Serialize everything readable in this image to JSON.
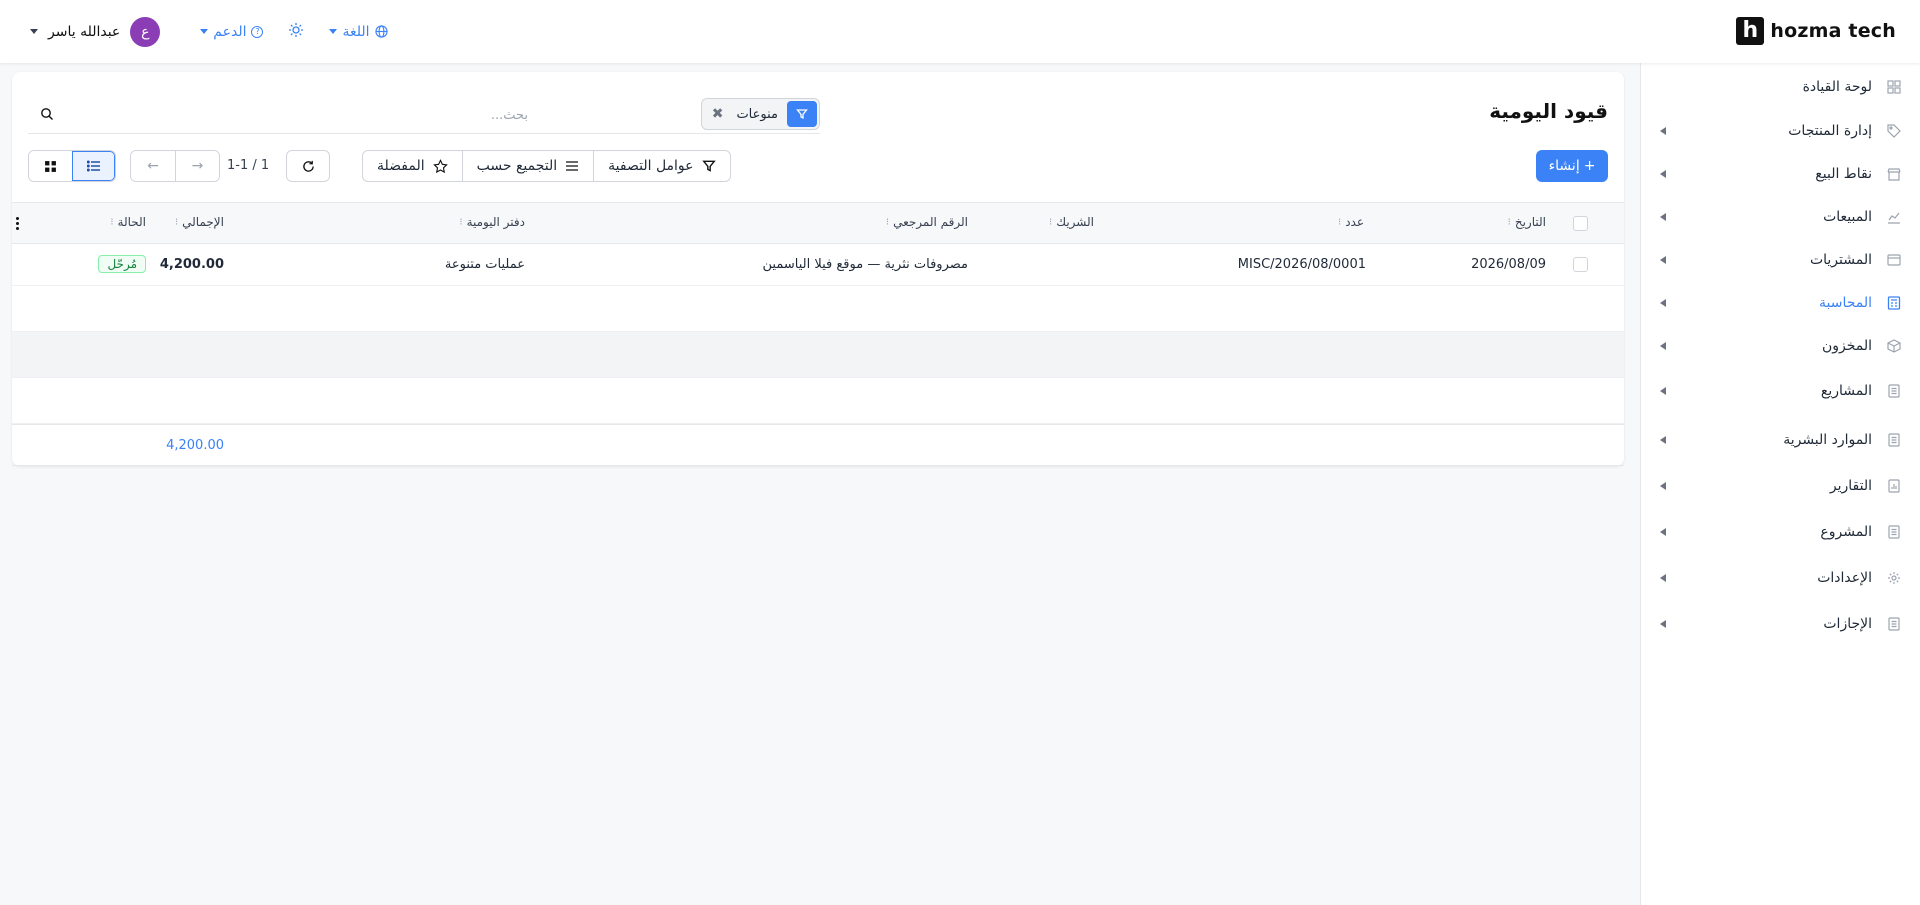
{
  "brand": {
    "logo_letter": "h",
    "name": "hozma tech"
  },
  "header": {
    "user_name": "عبدالله ياسر",
    "avatar_initial": "ع",
    "support_label": "الدعم",
    "language_label": "اللغة"
  },
  "sidebar": {
    "items": [
      {
        "label": "لوحة القيادة",
        "icon": "dashboard-grid-icon"
      },
      {
        "label": "إدارة المنتجات",
        "icon": "tag-icon"
      },
      {
        "label": "نقاط البيع",
        "icon": "store-icon"
      },
      {
        "label": "المبيعات",
        "icon": "trending-chart-icon"
      },
      {
        "label": "المشتريات",
        "icon": "wallet-icon"
      },
      {
        "label": "المحاسبة",
        "icon": "calculator-icon",
        "active": true
      },
      {
        "label": "المخزون",
        "icon": "box-icon"
      },
      {
        "label": "المشاريع",
        "icon": "document-icon"
      },
      {
        "label": "الموارد البشرية",
        "icon": "document-icon"
      },
      {
        "label": "التقارير",
        "icon": "report-icon"
      },
      {
        "label": "المشروع",
        "icon": "document-icon"
      },
      {
        "label": "الإعدادات",
        "icon": "gear-icon"
      },
      {
        "label": "الإجازات",
        "icon": "document-icon"
      }
    ]
  },
  "page": {
    "title": "قيود اليومية",
    "search_placeholder": "بحث...",
    "facet_value": "منوعات",
    "create_label": "إنشاء",
    "filters_label": "عوامل التصفية",
    "group_by_label": "التجميع حسب",
    "favorites_label": "المفضلة",
    "pager": "1-1 / 1"
  },
  "table": {
    "columns": {
      "date": "التاريخ",
      "number": "عدد",
      "partner": "الشريك",
      "reference": "الرقم المرجعي",
      "journal": "دفتر اليومية",
      "total": "الإجمالي",
      "status": "الحالة"
    },
    "rows": [
      {
        "date": "2026/08/09",
        "number": "MISC/2026/08/0001",
        "partner": "",
        "reference": "مصروفات نثرية — موقع فيلا الياسمين",
        "journal": "عمليات متنوعة",
        "total": "4,200.00",
        "status": "مُرحّل"
      }
    ],
    "footer_total": "4,200.00"
  },
  "colors": {
    "accent": "#3b82f6",
    "avatar": "#8b3db5",
    "posted_badge": "#15803d"
  }
}
